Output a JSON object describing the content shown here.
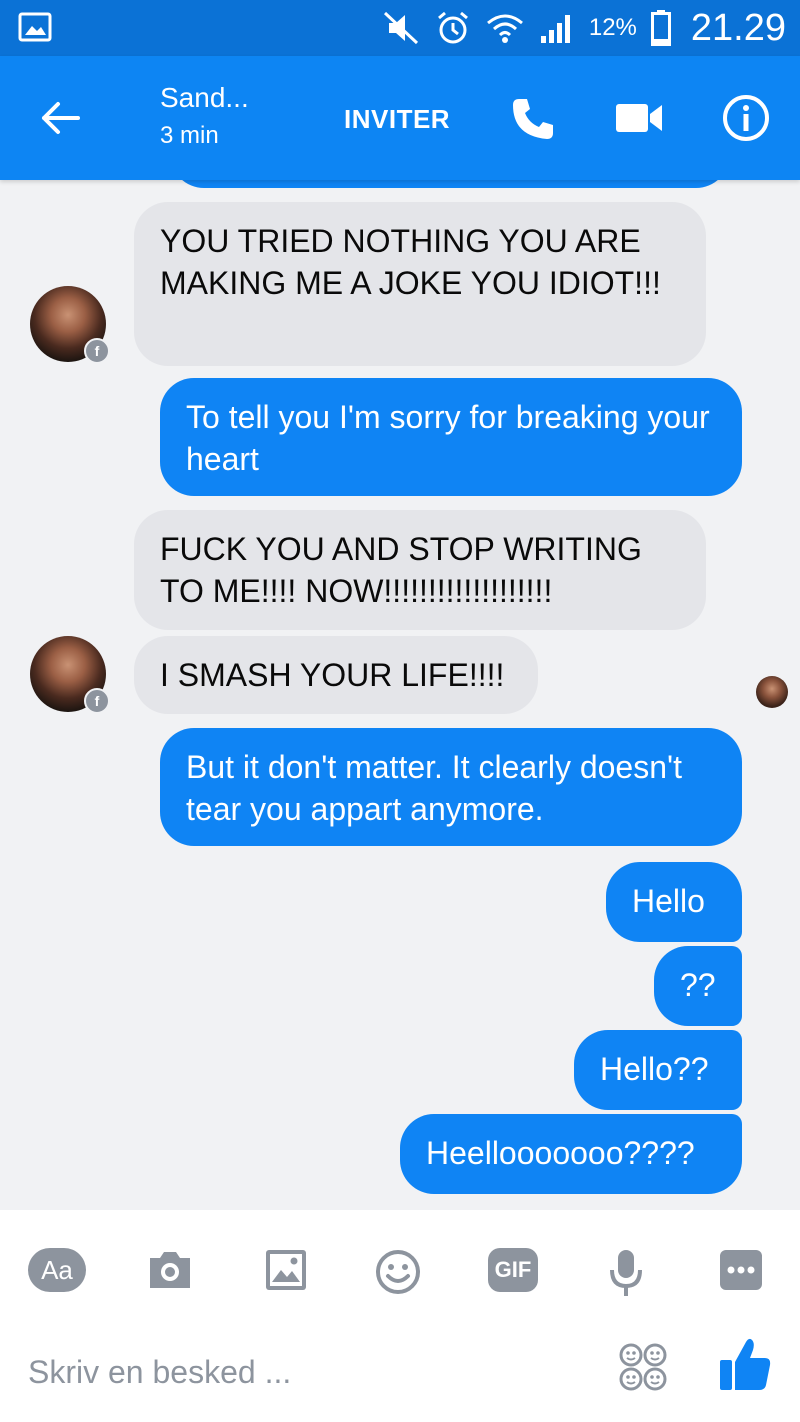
{
  "status_bar": {
    "battery_percent": "12%",
    "time": "21.29",
    "icons": [
      "gallery-icon",
      "mute-icon",
      "alarm-icon",
      "wifi-icon",
      "signal-icon",
      "battery-icon"
    ]
  },
  "header": {
    "contact_name": "Sand...",
    "last_active": "3 min",
    "invite_label": "INVITER",
    "icons": [
      "back-arrow-icon",
      "phone-icon",
      "video-camera-icon",
      "info-icon"
    ],
    "color": "#0d85f3"
  },
  "messages": [
    {
      "from": "them",
      "text": "YOU TRIED NOTHING YOU ARE MAKING ME A JOKE YOU IDIOT!!!"
    },
    {
      "from": "me",
      "text": "To tell you I'm sorry for breaking your heart"
    },
    {
      "from": "them",
      "text": "FUCK YOU AND STOP WRITING TO ME!!!! NOW!!!!!!!!!!!!!!!!!!!"
    },
    {
      "from": "them",
      "text": "I SMASH YOUR LIFE!!!!"
    },
    {
      "from": "me",
      "text": "But it don't matter. It clearly doesn't tear you appart anymore."
    },
    {
      "from": "me",
      "text": "Hello"
    },
    {
      "from": "me",
      "text": "??"
    },
    {
      "from": "me",
      "text": "Hello??"
    },
    {
      "from": "me",
      "text": "Heellooooooo????"
    }
  ],
  "composer": {
    "aa_label": "Aa",
    "gif_label": "GIF",
    "placeholder": "Skriv en besked ...",
    "icons": [
      "camera-icon",
      "image-icon",
      "emoji-icon",
      "microphone-icon",
      "more-icon",
      "sticker-icon",
      "thumbs-up-icon"
    ]
  },
  "colors": {
    "outgoing_bubble": "#0f84f4",
    "incoming_bubble": "#e4e5e9",
    "background": "#f1f2f4"
  }
}
